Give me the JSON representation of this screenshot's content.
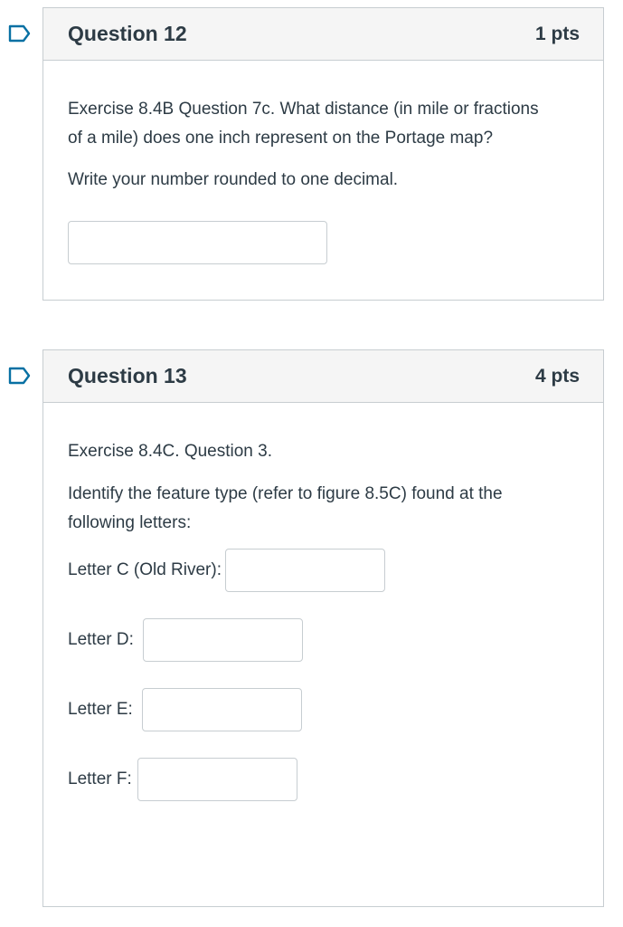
{
  "questions": [
    {
      "title": "Question 12",
      "points": "1 pts",
      "prompt_line1": "Exercise 8.4B Question 7c.  What distance (in mile or fractions",
      "prompt_line2": "of a mile) does one inch represent on the Portage map?",
      "instruction": "Write your number rounded to one decimal.",
      "answer": {
        "value": "",
        "placeholder": ""
      }
    },
    {
      "title": "Question 13",
      "points": "4 pts",
      "prompt_line1": "Exercise 8.4C. Question 3.",
      "prompt_line2": "Identify the feature type (refer to figure 8.5C) found at the",
      "prompt_line3": "following letters:",
      "blanks": [
        {
          "label": "Letter C (Old River):",
          "value": ""
        },
        {
          "label": "Letter D:",
          "value": ""
        },
        {
          "label": "Letter E:",
          "value": ""
        },
        {
          "label": "Letter F:",
          "value": ""
        }
      ]
    }
  ],
  "icons": {
    "flag": "bookmark-flag-icon"
  },
  "colors": {
    "flag": "#0770a3",
    "border": "#c7cdd1",
    "header_bg": "#f5f5f5",
    "text": "#2d3b45"
  }
}
